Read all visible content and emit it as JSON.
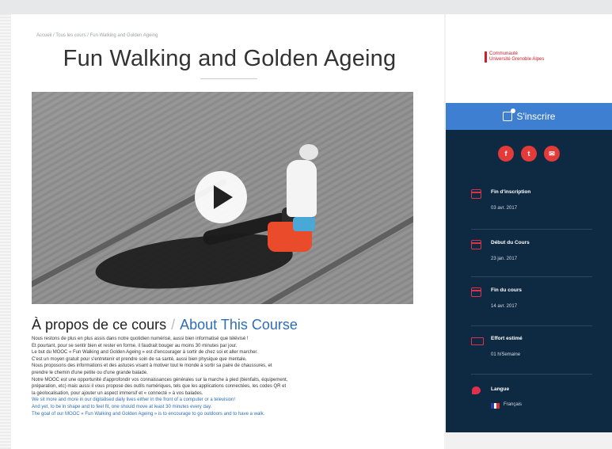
{
  "breadcrumb": "Accueil / Tous les cours / Fun Walking and Golden Ageing",
  "title": "Fun Walking and Golden Ageing",
  "about": {
    "heading_fr": "À propos de ce cours",
    "separator": "/",
    "heading_en": "About This Course",
    "paragraphs_fr": [
      "Nous restons de plus en plus assis dans notre quotidien numérisé, aussi bien informatisé que télévisé !",
      "Et pourtant, pour se sentir bien et rester en forme, il faudrait bouger au moins 30 minutes par jour.",
      "Le but du MOOC « Fun Walking and Golden Ageing » est d'encourager à sortir de chez soi et aller marcher.",
      "C'est un moyen gratuit pour s'entretenir et prendre soin de sa santé, aussi bien physique que mentale.",
      "Nous proposons des informations et des astuces visant à motiver tout le monde à sortir sa paire de chaussures, et",
      "prendre le chemin d'une petite ou d'une grande balade.",
      "Notre MOOC est une opportunité d'approfondir vos connaissances générales sur la marche à pied (bienfaits, équipement,",
      "préparation, etc) mais aussi il vous propose des outils numériques, tels que les applications connectées, les codes QR et",
      "la géolocalisation, pour ajouter un aspect immersif et « connecté » à vos balades."
    ],
    "paragraphs_en": [
      "We sit more and more in our digitalised daily lives either in the front of a computer or a television!",
      "And yet, to be in shape and to feel fit, one should move at least 30 minutes every day.",
      "The goal of our MOOC « Fun Walking and Golden Ageing » is to encourage to go outdoors and to have a walk."
    ]
  },
  "sidebar": {
    "logo_lines": [
      "Communauté",
      "Université Grenoble Alpes"
    ],
    "enroll_label": "S'inscrire",
    "share": [
      {
        "icon": "facebook-icon",
        "glyph": "f"
      },
      {
        "icon": "twitter-icon",
        "glyph": "t"
      },
      {
        "icon": "email-icon",
        "glyph": "✉"
      }
    ],
    "info": [
      {
        "title": "Fin d'inscription",
        "value": "03 avr. 2017"
      },
      {
        "title": "Début du Cours",
        "value": "23 jan. 2017"
      },
      {
        "title": "Fin du cours",
        "value": "14 avr. 2017"
      },
      {
        "title": "Effort estimé",
        "value": "01 h/Semaine"
      },
      {
        "title": "Langue",
        "value": "Français"
      }
    ]
  },
  "colors": {
    "accent_blue": "#3f7fd1",
    "panel_navy": "#0e2a43",
    "social_red": "#e33a3a",
    "link_blue": "#2f6db5"
  }
}
